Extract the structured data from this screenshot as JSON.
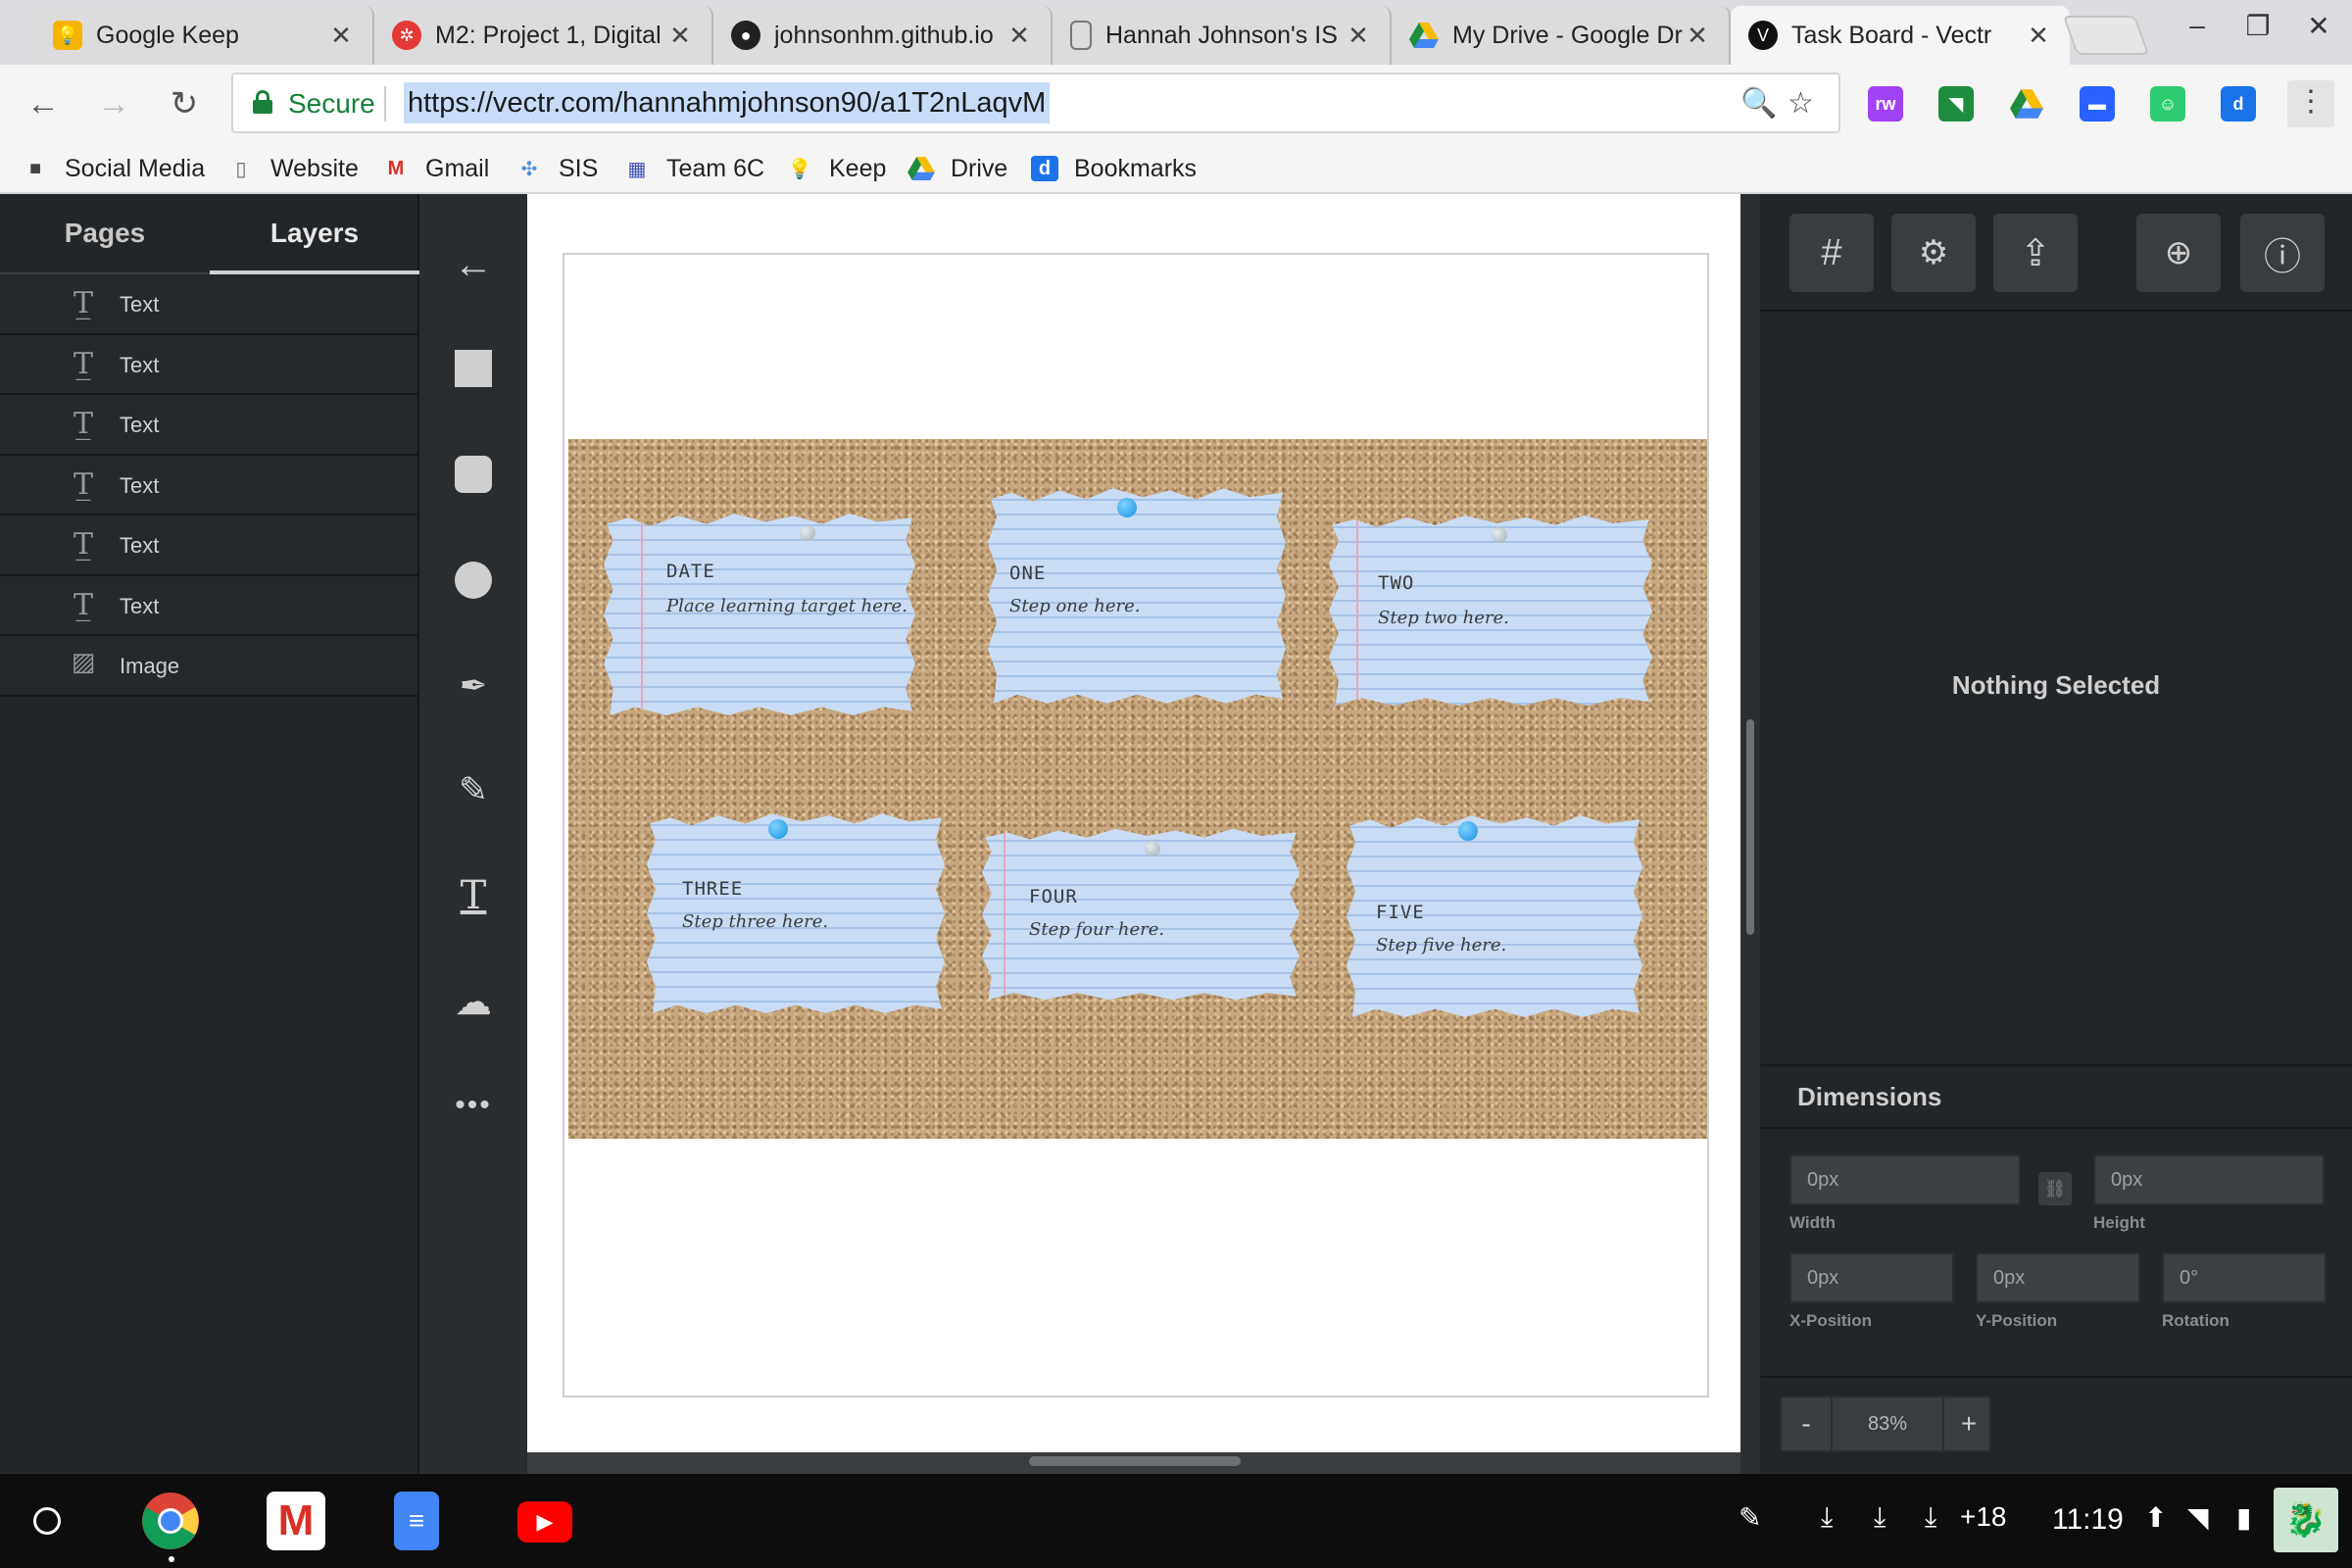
{
  "browser": {
    "tabs": [
      {
        "title": "Google Keep",
        "icon": "keep-icon",
        "color": "#f6b400"
      },
      {
        "title": "M2: Project 1, Digital",
        "icon": "canvas-icon",
        "color": "#e53935"
      },
      {
        "title": "johnsonhm.github.io",
        "icon": "github-icon",
        "color": "#222222"
      },
      {
        "title": "Hannah Johnson's IS",
        "icon": "doc-icon",
        "color": "#777777"
      },
      {
        "title": "My Drive - Google Dri",
        "icon": "drive-icon",
        "color": "#1e8e3e"
      },
      {
        "title": "Task Board - Vectr",
        "icon": "vectr-icon",
        "color": "#111111"
      }
    ],
    "close_glyph": "✕",
    "secure_label": "Secure",
    "url": "https://vectr.com/hannahmjohnson90/a1T2nLaqvM",
    "bookmarks": [
      {
        "label": "Social Media",
        "icon": "folder-icon"
      },
      {
        "label": "Website",
        "icon": "page-icon"
      },
      {
        "label": "Gmail",
        "icon": "gmail-icon"
      },
      {
        "label": "SIS",
        "icon": "sis-icon"
      },
      {
        "label": "Team 6C",
        "icon": "team-icon"
      },
      {
        "label": "Keep",
        "icon": "keep-icon"
      },
      {
        "label": "Drive",
        "icon": "drive-icon"
      },
      {
        "label": "Bookmarks",
        "icon": "bookmarks-icon"
      }
    ]
  },
  "left_panel": {
    "tabs": [
      "Pages",
      "Layers"
    ],
    "active_tab": "Layers",
    "layers": [
      {
        "name": "Text",
        "icon": "text-layer-icon"
      },
      {
        "name": "Text",
        "icon": "text-layer-icon"
      },
      {
        "name": "Text",
        "icon": "text-layer-icon"
      },
      {
        "name": "Text",
        "icon": "text-layer-icon"
      },
      {
        "name": "Text",
        "icon": "text-layer-icon"
      },
      {
        "name": "Text",
        "icon": "text-layer-icon"
      },
      {
        "name": "Image",
        "icon": "image-layer-icon"
      }
    ]
  },
  "tools": [
    "back-arrow-icon",
    "rectangle-icon",
    "rounded-rectangle-icon",
    "ellipse-icon",
    "pen-icon",
    "pencil-icon",
    "text-icon",
    "upload-icon",
    "more-icon"
  ],
  "canvas": {
    "notes": [
      {
        "title": "DATE",
        "text": "Place learning target here.",
        "pin": "clear"
      },
      {
        "title": "ONE",
        "text": "Step one here.",
        "pin": "blue"
      },
      {
        "title": "TWO",
        "text": "Step two here.",
        "pin": "clear"
      },
      {
        "title": "THREE",
        "text": "Step three here.",
        "pin": "blue"
      },
      {
        "title": "FOUR",
        "text": "Step four here.",
        "pin": "clear"
      },
      {
        "title": "FIVE",
        "text": "Step five here.",
        "pin": "blue"
      }
    ]
  },
  "right_panel": {
    "buttons": [
      "grid-settings-icon",
      "page-settings-icon",
      "export-icon",
      "add-page-icon",
      "info-icon"
    ],
    "nothing_selected": "Nothing Selected",
    "dimensions_title": "Dimensions",
    "width": {
      "value": "0px",
      "label": "Width"
    },
    "height": {
      "value": "0px",
      "label": "Height"
    },
    "x": {
      "value": "0px",
      "label": "X-Position"
    },
    "y": {
      "value": "0px",
      "label": "Y-Position"
    },
    "rotation": {
      "value": "0°",
      "label": "Rotation"
    },
    "zoom": {
      "minus": "-",
      "value": "83%",
      "plus": "+"
    }
  },
  "shelf": {
    "apps": [
      "chrome-icon",
      "gmail-icon",
      "docs-icon",
      "youtube-icon"
    ],
    "notification_count": "+18",
    "time": "11:19"
  }
}
